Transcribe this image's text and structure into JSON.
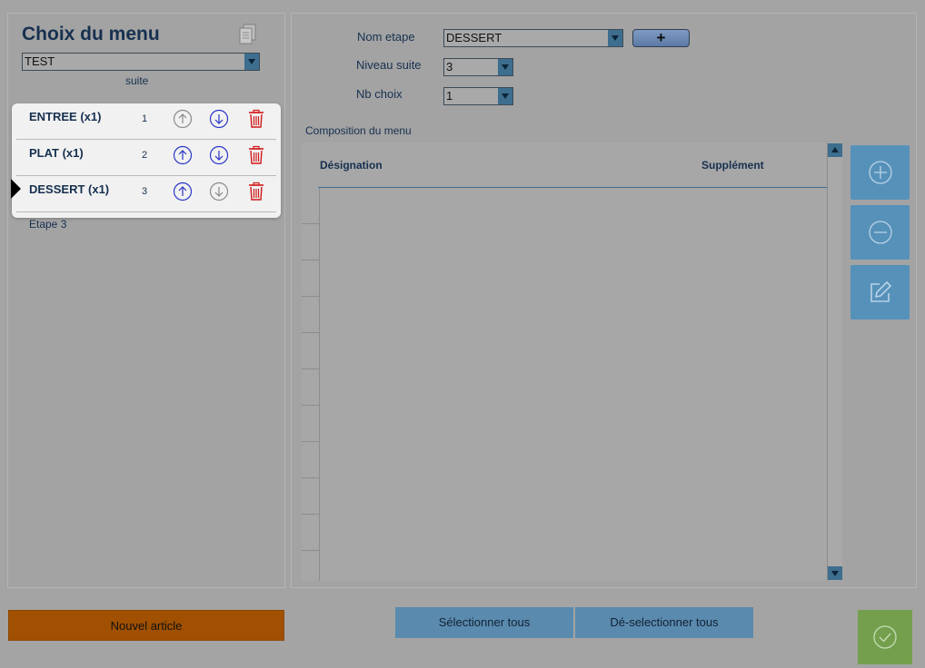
{
  "left_panel": {
    "title": "Choix du menu",
    "menu_select": "TEST",
    "suite_header": "suite",
    "steps": [
      {
        "name": "ENTREE  (x1)",
        "suite": "1"
      },
      {
        "name": "PLAT  (x1)",
        "suite": "2"
      },
      {
        "name": "DESSERT  (x1)",
        "suite": "3"
      }
    ],
    "current_step_label": "Etape 3"
  },
  "form": {
    "nom_etape_label": "Nom etape",
    "nom_etape_value": "DESSERT",
    "add_button": "+",
    "niveau_suite_label": "Niveau suite",
    "niveau_suite_value": "3",
    "nb_choix_label": "Nb choix",
    "nb_choix_value": "1"
  },
  "composition": {
    "label": "Composition du menu",
    "columns": [
      "Désignation",
      "Supplément"
    ]
  },
  "footer": {
    "new_article": "Nouvel article",
    "select_all": "Sélectionner tous",
    "deselect_all": "Dé-selectionner tous"
  },
  "colors": {
    "title": "#16304f",
    "side_button": "#5691ba",
    "new_article": "#a05000",
    "validate": "#74a04e",
    "delete_icon": "#d01818",
    "arrow_active": "#2a36c8",
    "arrow_inactive": "#8a8a8a"
  },
  "icons": {
    "copy": "document-copy-icon",
    "move_up": "arrow-up-circle-icon",
    "move_down": "arrow-down-circle-icon",
    "delete": "trash-icon",
    "add": "plus-circle-icon",
    "remove": "minus-circle-icon",
    "edit": "edit-icon",
    "validate": "check-circle-icon"
  }
}
